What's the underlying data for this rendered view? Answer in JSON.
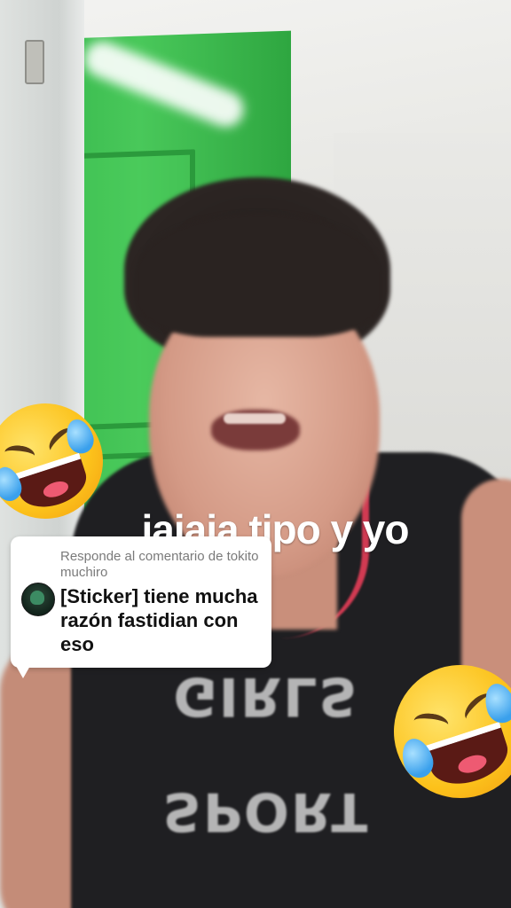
{
  "video": {
    "caption": "jajaja tipo y yo",
    "shirt_print": "SPORT GIRLS"
  },
  "reply_sticker": {
    "header": "Responde al comentario de tokito muchiro",
    "comment": "[Sticker] tiene mucha razón fastidian con eso",
    "avatar_icon": "profile-avatar-icon"
  },
  "overlays": {
    "emoji_left": "rolling-on-floor-laughing-icon",
    "emoji_right": "rolling-on-floor-laughing-icon"
  },
  "colors": {
    "door_green": "#3fbd4f",
    "shirt_black": "#1f1f22",
    "shirt_trim": "#d13a52",
    "card_bg": "#ffffff"
  }
}
